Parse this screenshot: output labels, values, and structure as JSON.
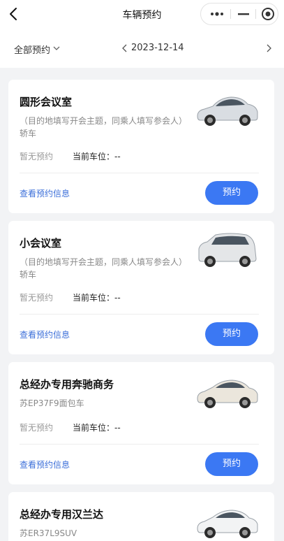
{
  "header": {
    "title": "车辆预约"
  },
  "filter": {
    "scope_label": "全部预约",
    "date": "2023-12-14"
  },
  "cards": [
    {
      "title": "圆形会议室",
      "desc": "（目的地填写开会主题，同乘人填写参会人）轿车",
      "status": "暂无预约",
      "space_label": "当前车位：--",
      "link": "查看预约信息",
      "button": "预约",
      "car_color": "#d9dde2"
    },
    {
      "title": "小会议室",
      "desc": "（目的地填写开会主题，同乘人填写参会人）轿车",
      "status": "暂无预约",
      "space_label": "当前车位：--",
      "link": "查看预约信息",
      "button": "预约",
      "car_color": "#e4e6e8"
    },
    {
      "title": "总经办专用奔驰商务",
      "desc": "苏EP37F9面包车",
      "status": "暂无预约",
      "space_label": "当前车位：--",
      "link": "查看预约信息",
      "button": "预约",
      "car_color": "#ebe6dc"
    },
    {
      "title": "总经办专用汉兰达",
      "desc": "苏ER37L9SUV",
      "status": "",
      "space_label": "",
      "link": "",
      "button": "",
      "car_color": "#f2f3f4"
    }
  ],
  "icons": {
    "back": "chevron-left-icon",
    "more": "more-dots-icon",
    "minimize": "minimize-icon",
    "close": "target-close-icon",
    "prev": "chevron-left-icon",
    "next": "chevron-right-icon"
  }
}
